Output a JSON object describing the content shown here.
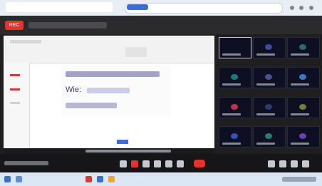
{
  "meeting": {
    "record_badge": "REC"
  },
  "slide": {
    "label": "Wie:",
    "line2": "",
    "line3": ""
  },
  "colors": {
    "accent_red": "#e5322d",
    "browser_blue": "#3b6fcf",
    "meeting_bg": "#1f1f22"
  },
  "icons": [
    "mic-icon",
    "video-icon",
    "share-icon",
    "chat-icon",
    "people-icon",
    "more-icon",
    "end-call-icon"
  ]
}
